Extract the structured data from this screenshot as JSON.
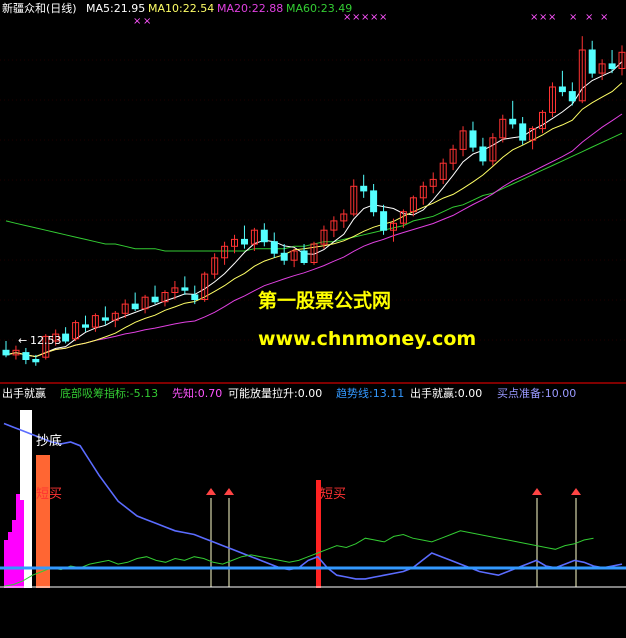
{
  "colors": {
    "background": "#000000",
    "up": "#ff3333",
    "down": "#54ffff",
    "ma5": "#ffffff",
    "ma10": "#ffff66",
    "ma20": "#e040e0",
    "ma60": "#33cc33",
    "divider": "#cc0000",
    "indicator_line": "#5b6cff",
    "trend_line": "#3399ff",
    "xianzhi": "#ff55ff",
    "buy_ready": "#9999ff",
    "arrow": "#ff4444",
    "watermark": "#ffff00"
  },
  "header": {
    "title": "新疆众和(日线)",
    "ma5": "MA5:21.95",
    "ma10": "MA10:22.54",
    "ma20": "MA20:22.88",
    "ma60": "MA60:23.49"
  },
  "indicator_header": {
    "name": "出手就赢",
    "dibu": "底部吸筹指标:-5.13",
    "xianzhi": "先知:0.70",
    "kenengfang": "可能放量拉升:0.00",
    "qushi": "趋势线:13.11",
    "chushou": "出手就赢:0.00",
    "maidian": "买点准备:10.00"
  },
  "annotations": {
    "low_price": "12.53",
    "chaodi": "抄底",
    "duanmai_1": "短买",
    "duanmai_2": "短买",
    "x_mark": "×"
  },
  "watermark": {
    "line1": "第一股票公式网",
    "line2": "www.chnmoney.com"
  },
  "chart_data": {
    "type": "candlestick",
    "price_axis": {
      "min": 12.0,
      "max": 27.5
    },
    "candles": [
      [
        13.2,
        13.6,
        12.9,
        13.0
      ],
      [
        13.0,
        13.4,
        12.8,
        13.2
      ],
      [
        13.1,
        13.3,
        12.6,
        12.8
      ],
      [
        12.8,
        13.0,
        12.53,
        12.7
      ],
      [
        12.9,
        13.9,
        12.8,
        13.8
      ],
      [
        13.6,
        14.1,
        13.4,
        13.9
      ],
      [
        13.9,
        14.2,
        13.5,
        13.6
      ],
      [
        13.7,
        14.5,
        13.6,
        14.4
      ],
      [
        14.3,
        14.7,
        14.0,
        14.2
      ],
      [
        14.2,
        14.8,
        14.0,
        14.7
      ],
      [
        14.6,
        15.1,
        14.3,
        14.5
      ],
      [
        14.5,
        14.9,
        14.2,
        14.8
      ],
      [
        14.8,
        15.4,
        14.6,
        15.2
      ],
      [
        15.2,
        15.7,
        14.9,
        15.0
      ],
      [
        15.0,
        15.6,
        14.8,
        15.5
      ],
      [
        15.5,
        16.0,
        15.2,
        15.3
      ],
      [
        15.3,
        15.8,
        15.1,
        15.7
      ],
      [
        15.7,
        16.2,
        15.4,
        15.9
      ],
      [
        15.9,
        16.4,
        15.6,
        15.8
      ],
      [
        15.6,
        16.0,
        15.2,
        15.4
      ],
      [
        15.4,
        16.6,
        15.3,
        16.5
      ],
      [
        16.5,
        17.4,
        16.3,
        17.2
      ],
      [
        17.2,
        17.9,
        16.9,
        17.7
      ],
      [
        17.7,
        18.2,
        17.4,
        18.0
      ],
      [
        18.0,
        18.6,
        17.6,
        17.8
      ],
      [
        17.8,
        18.5,
        17.5,
        18.4
      ],
      [
        18.4,
        18.7,
        17.7,
        17.9
      ],
      [
        17.9,
        18.3,
        17.2,
        17.4
      ],
      [
        17.4,
        17.8,
        16.9,
        17.1
      ],
      [
        17.1,
        17.6,
        16.8,
        17.5
      ],
      [
        17.5,
        17.8,
        16.9,
        17.0
      ],
      [
        17.0,
        17.9,
        16.9,
        17.8
      ],
      [
        17.8,
        18.6,
        17.6,
        18.4
      ],
      [
        18.4,
        19.0,
        18.1,
        18.8
      ],
      [
        18.8,
        19.3,
        18.5,
        19.1
      ],
      [
        19.1,
        20.6,
        19.0,
        20.3
      ],
      [
        20.3,
        20.8,
        19.8,
        20.1
      ],
      [
        20.1,
        20.4,
        19.0,
        19.2
      ],
      [
        19.2,
        19.5,
        18.2,
        18.4
      ],
      [
        18.4,
        18.9,
        17.9,
        18.7
      ],
      [
        18.7,
        19.3,
        18.5,
        19.2
      ],
      [
        19.2,
        19.9,
        19.0,
        19.8
      ],
      [
        19.8,
        20.5,
        19.5,
        20.3
      ],
      [
        20.3,
        20.9,
        20.0,
        20.6
      ],
      [
        20.6,
        21.5,
        20.4,
        21.3
      ],
      [
        21.3,
        22.1,
        21.0,
        21.9
      ],
      [
        21.9,
        22.9,
        21.6,
        22.7
      ],
      [
        22.7,
        23.1,
        21.8,
        22.0
      ],
      [
        22.0,
        22.4,
        21.2,
        21.4
      ],
      [
        21.4,
        22.6,
        21.2,
        22.4
      ],
      [
        22.4,
        23.4,
        22.2,
        23.2
      ],
      [
        23.2,
        24.0,
        22.8,
        23.0
      ],
      [
        23.0,
        23.3,
        22.1,
        22.3
      ],
      [
        22.3,
        22.9,
        21.9,
        22.8
      ],
      [
        22.8,
        23.6,
        22.6,
        23.5
      ],
      [
        23.5,
        24.8,
        23.3,
        24.6
      ],
      [
        24.6,
        25.3,
        24.2,
        24.4
      ],
      [
        24.4,
        24.8,
        23.8,
        24.0
      ],
      [
        24.0,
        26.8,
        23.9,
        26.2
      ],
      [
        26.2,
        26.6,
        25.0,
        25.2
      ],
      [
        25.2,
        25.8,
        24.9,
        25.6
      ],
      [
        25.6,
        26.2,
        25.2,
        25.4
      ],
      [
        25.4,
        26.4,
        25.1,
        26.1
      ]
    ],
    "ma60": [
      18.8,
      18.7,
      18.6,
      18.5,
      18.4,
      18.3,
      18.2,
      18.1,
      18.0,
      17.9,
      17.8,
      17.8,
      17.7,
      17.6,
      17.6,
      17.6,
      17.5,
      17.5,
      17.5,
      17.5,
      17.5,
      17.5,
      17.5,
      17.5,
      17.5,
      17.6,
      17.6,
      17.6,
      17.6,
      17.7,
      17.7,
      17.8,
      17.9,
      17.9,
      18.0,
      18.1,
      18.2,
      18.3,
      18.4,
      18.5,
      18.6,
      18.8,
      18.9,
      19.0,
      19.2,
      19.4,
      19.5,
      19.7,
      19.9,
      20.0,
      20.2,
      20.4,
      20.6,
      20.8,
      21.0,
      21.2,
      21.4,
      21.6,
      21.8,
      22.0,
      22.2,
      22.4,
      22.6
    ],
    "indicator": {
      "trend": [
        90,
        88,
        86,
        84,
        82,
        80,
        79,
        80,
        78,
        70,
        62,
        55,
        48,
        44,
        40,
        38,
        36,
        34,
        32,
        31,
        30,
        28,
        26,
        24,
        22,
        20,
        18,
        16,
        14,
        12,
        11,
        12,
        16,
        18,
        12,
        8,
        7,
        6,
        6,
        7,
        8,
        9,
        10,
        12,
        16,
        20,
        18,
        16,
        14,
        12,
        10,
        9,
        8,
        10,
        12,
        14,
        16,
        13,
        12,
        14,
        16,
        15,
        13,
        12,
        13,
        14
      ],
      "green": [
        2,
        3,
        5,
        8,
        10,
        12,
        11,
        13,
        12,
        14,
        15,
        16,
        14,
        15,
        17,
        18,
        16,
        15,
        17,
        16,
        18,
        17,
        15,
        14,
        16,
        18,
        19,
        18,
        17,
        16,
        15,
        16,
        18,
        20,
        22,
        24,
        23,
        25,
        28,
        27,
        26,
        29,
        30,
        28,
        27,
        26,
        28,
        30,
        32,
        31,
        30,
        29,
        28,
        27,
        26,
        25,
        24,
        23,
        22,
        24,
        25,
        27,
        28
      ],
      "duanmai_positions": [
        31
      ],
      "arrow_positions": [
        20,
        22,
        31,
        52,
        56
      ],
      "chaodi_positions": [
        3,
        4
      ]
    }
  }
}
